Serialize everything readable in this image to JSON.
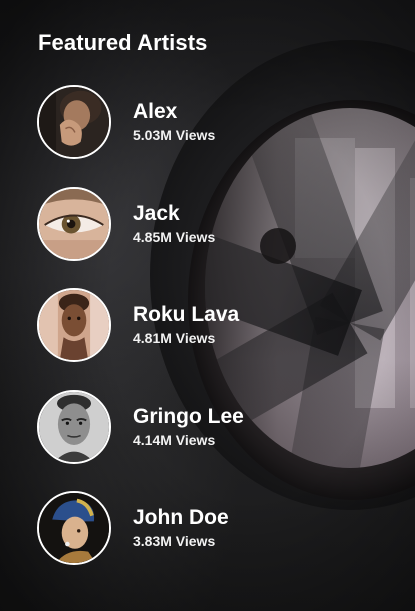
{
  "section": {
    "title": "Featured Artists"
  },
  "artists": [
    {
      "name": "Alex",
      "views": "5.03M Views",
      "avatar_icon": "portrait-praying-hands"
    },
    {
      "name": "Jack",
      "views": "4.85M Views",
      "avatar_icon": "portrait-eye-closeup"
    },
    {
      "name": "Roku Lava",
      "views": "4.81M Views",
      "avatar_icon": "portrait-young-girl"
    },
    {
      "name": "Gringo Lee",
      "views": "4.14M Views",
      "avatar_icon": "portrait-man-bw"
    },
    {
      "name": "John Doe",
      "views": "3.83M Views",
      "avatar_icon": "portrait-pearl-earring"
    }
  ],
  "colors": {
    "background": "#1d1d1f",
    "text": "#ffffff",
    "avatar_border": "#ffffff"
  }
}
